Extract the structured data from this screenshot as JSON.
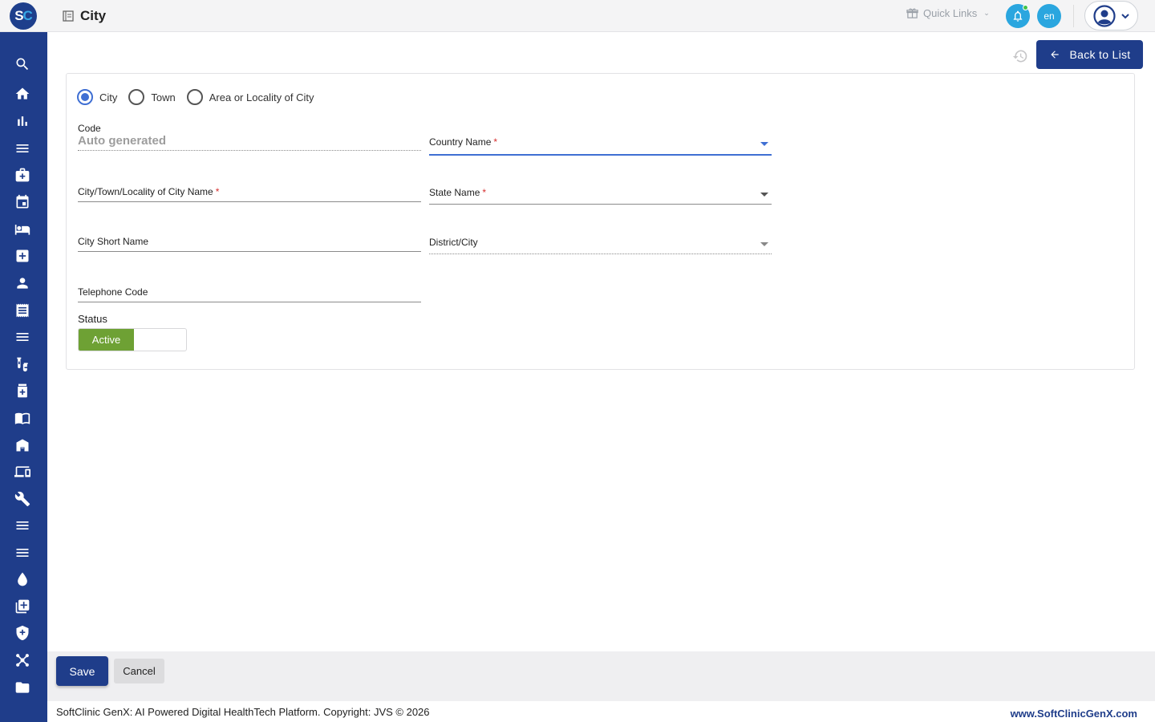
{
  "header": {
    "logo_s": "S",
    "logo_c": "C",
    "title": "City",
    "quick_links": "Quick Links",
    "language": "en"
  },
  "sidebar": {
    "icons": [
      "search-icon",
      "home-icon",
      "bar-chart-icon",
      "menu-icon",
      "medical-bag-icon",
      "calendar-icon",
      "bed-icon",
      "medical-plus-icon",
      "person-icon",
      "receipt-icon",
      "menu-icon",
      "lab-tubes-icon",
      "medicine-bottle-icon",
      "book-icon",
      "store-icon",
      "devices-icon",
      "wrench-icon",
      "menu-icon",
      "menu-icon",
      "blood-drop-icon",
      "add-library-icon",
      "shield-icon",
      "hub-icon",
      "folder-icon"
    ]
  },
  "toolbar": {
    "back_label": "Back to List"
  },
  "form": {
    "type_options": [
      "City",
      "Town",
      "Area or Locality of City"
    ],
    "selected_type": "City",
    "code_label": "Code",
    "code_value": "Auto generated",
    "country_label": "Country Name",
    "name_label": "City/Town/Locality of City Name",
    "state_label": "State Name",
    "short_name_label": "City Short Name",
    "district_label": "District/City",
    "telephone_label": "Telephone Code",
    "required_mark": "*",
    "status_label": "Status",
    "status_value": "Active"
  },
  "actions": {
    "save_label": "Save",
    "cancel_label": "Cancel"
  },
  "footer": {
    "copyright": "SoftClinic GenX: AI Powered Digital HealthTech Platform. Copyright: JVS © 2026",
    "website": "www.SoftClinicGenX.com"
  },
  "colors": {
    "primary": "#1f3d8a",
    "accent": "#3f6fd3",
    "active_green": "#6ea134",
    "notification": "#2aa6df"
  }
}
